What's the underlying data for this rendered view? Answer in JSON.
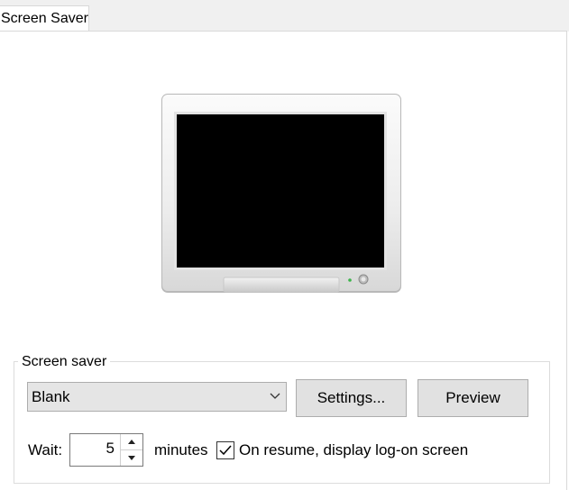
{
  "tab": {
    "label": "Screen Saver"
  },
  "screen_saver": {
    "group_label": "Screen saver",
    "selected": "Blank",
    "settings_label": "Settings...",
    "preview_label": "Preview",
    "wait_label": "Wait:",
    "wait_value": "5",
    "minutes_label": "minutes",
    "resume_checked": true,
    "resume_label": "On resume, display log-on screen"
  },
  "icons": {
    "dropdown": "chevron-down-icon",
    "spin_up": "chevron-up-icon",
    "spin_down": "chevron-down-icon",
    "check": "checkmark-icon",
    "monitor": "monitor-preview"
  },
  "colors": {
    "power_led": "#3cb44b",
    "screen": "#000000"
  }
}
